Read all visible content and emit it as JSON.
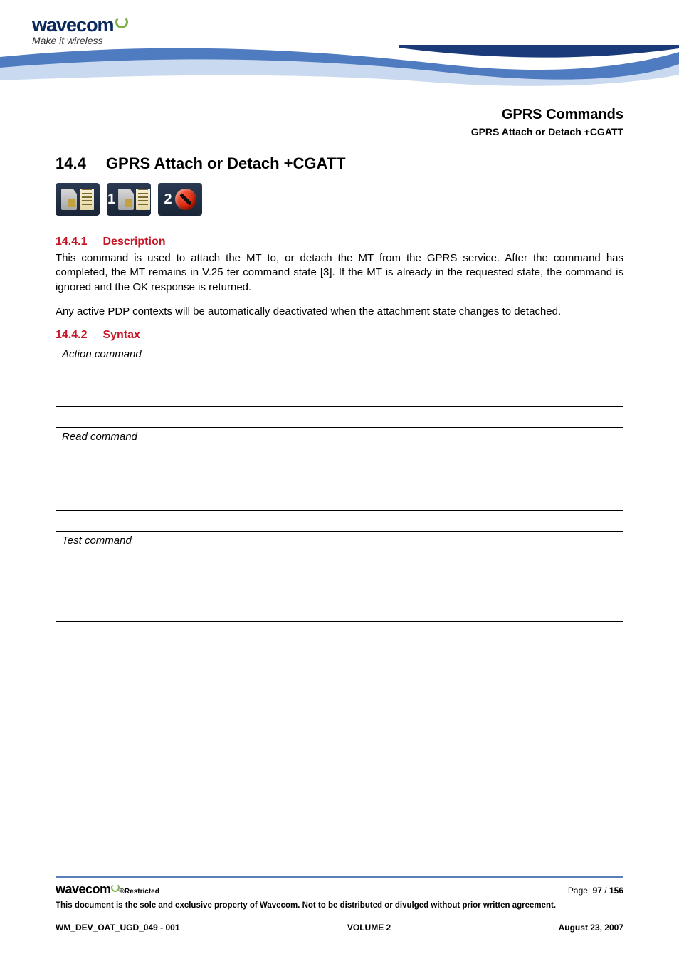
{
  "logo": {
    "brand": "wavecom",
    "tagline": "Make it wireless"
  },
  "header": {
    "title": "GPRS Commands",
    "subtitle": "GPRS Attach or Detach +CGATT"
  },
  "section": {
    "number": "14.4",
    "title": "GPRS Attach or Detach +CGATT"
  },
  "icons": {
    "badge1": "1",
    "badge2": "2"
  },
  "subsections": {
    "desc": {
      "num": "14.4.1",
      "title": "Description"
    },
    "syntax": {
      "num": "14.4.2",
      "title": "Syntax"
    }
  },
  "paragraphs": {
    "p1": "This command is used to attach the MT to, or detach the MT from the GPRS service. After the command has completed, the MT remains in V.25 ter command state [3]. If the MT is already in the requested state, the command is ignored and the OK response is returned.",
    "p2": "Any active PDP contexts will be automatically deactivated when the attachment state changes to detached."
  },
  "syntax_boxes": {
    "action": "Action command",
    "read": "Read command",
    "test": "Test command"
  },
  "footer": {
    "brand": "wavecom",
    "restricted": "©Restricted",
    "page_label": "Page: ",
    "page_current": "97",
    "page_sep": " / ",
    "page_total": "156",
    "disclaimer": "This document is the sole and exclusive property of Wavecom. Not to be distributed or divulged without prior written agreement.",
    "doc_id": "WM_DEV_OAT_UGD_049 - 001",
    "volume": "VOLUME 2",
    "date": "August 23, 2007"
  }
}
